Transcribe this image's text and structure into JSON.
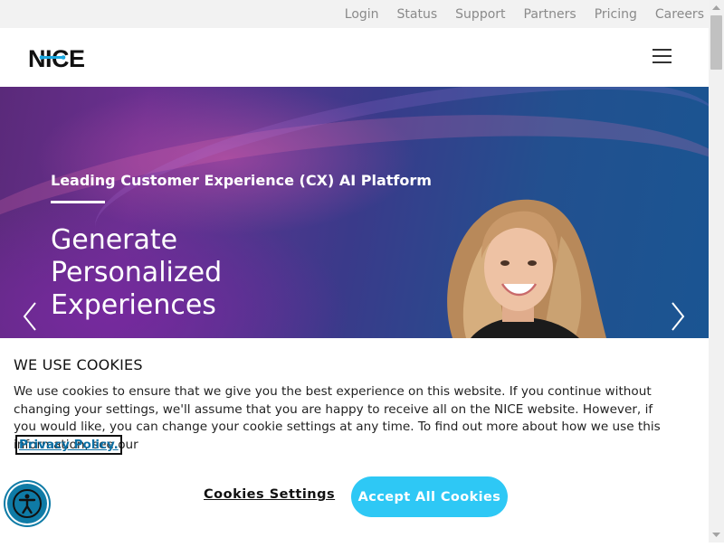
{
  "topbar": {
    "links": [
      "Login",
      "Status",
      "Support",
      "Partners",
      "Pricing",
      "Careers"
    ]
  },
  "header": {
    "logo_text": "NICE"
  },
  "hero": {
    "eyebrow": "Leading Customer Experience (CX) AI Platform",
    "headline": [
      "Generate",
      "Personalized",
      "Experiences"
    ]
  },
  "cookie_banner": {
    "title": "WE USE COOKIES",
    "body": "We use cookies to ensure that we give you the best experience on this website. If you continue without changing your settings, we'll assume that you are happy to receive all on the NICE website. However, if you would like, you can change your cookie settings at any time. To find out more about how we use this information, see our",
    "privacy_link": "Privacy Policy.",
    "settings_button": "Cookies Settings",
    "accept_button": "Accept All Cookies"
  },
  "colors": {
    "accent": "#2ec8f5",
    "accessibility_button": "#0f7ba6",
    "privacy_link": "#0b6fa4"
  },
  "icons": [
    "hamburger-menu-icon",
    "chevron-left-icon",
    "chevron-right-icon",
    "accessibility-icon",
    "scroll-up-icon",
    "scroll-down-icon"
  ]
}
